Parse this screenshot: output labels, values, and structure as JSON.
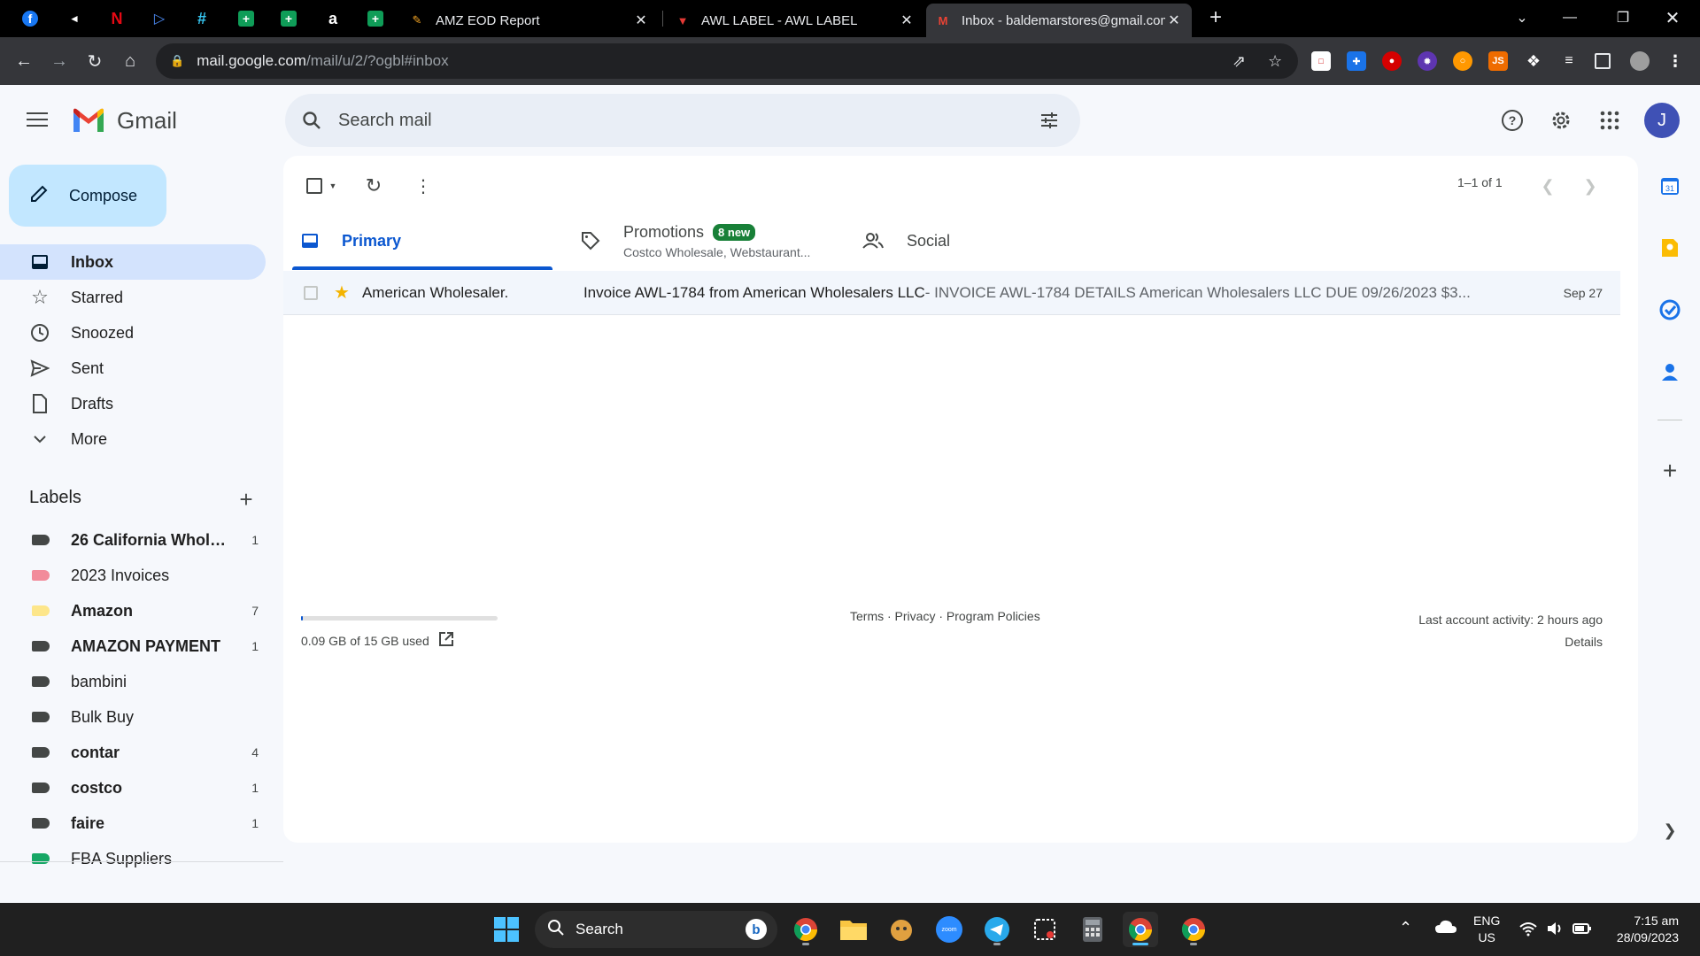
{
  "browser": {
    "tabs": [
      {
        "title": "AMZ EOD Report",
        "active": false
      },
      {
        "title": "AWL LABEL - AWL LABEL",
        "active": false
      },
      {
        "title": "Inbox - baldemarstores@gmail.com",
        "active": true
      }
    ],
    "url_host": "mail.google.com",
    "url_path": "/mail/u/2/?ogbl#inbox"
  },
  "gmail": {
    "brand": "Gmail",
    "search_placeholder": "Search mail",
    "avatar_letter": "J",
    "compose_label": "Compose",
    "nav": [
      {
        "label": "Inbox",
        "icon": "inbox-icon",
        "active": true
      },
      {
        "label": "Starred",
        "icon": "star-icon"
      },
      {
        "label": "Snoozed",
        "icon": "clock-icon"
      },
      {
        "label": "Sent",
        "icon": "send-icon"
      },
      {
        "label": "Drafts",
        "icon": "draft-icon"
      },
      {
        "label": "More",
        "icon": "chevron-down-icon"
      }
    ],
    "labels_title": "Labels",
    "labels": [
      {
        "name": "26 California Whole...",
        "count": "1",
        "bold": true,
        "color": "#444746"
      },
      {
        "name": "2023 Invoices",
        "count": "",
        "bold": false,
        "color": "#f28b9a"
      },
      {
        "name": "Amazon",
        "count": "7",
        "bold": true,
        "color": "#fde68a"
      },
      {
        "name": "AMAZON PAYMENT",
        "count": "1",
        "bold": true,
        "color": "#444746"
      },
      {
        "name": "bambini",
        "count": "",
        "bold": false,
        "color": "#444746"
      },
      {
        "name": "Bulk Buy",
        "count": "",
        "bold": false,
        "color": "#444746"
      },
      {
        "name": "contar",
        "count": "4",
        "bold": true,
        "color": "#444746"
      },
      {
        "name": "costco",
        "count": "1",
        "bold": true,
        "color": "#444746"
      },
      {
        "name": "faire",
        "count": "1",
        "bold": true,
        "color": "#444746"
      },
      {
        "name": "FBA Suppliers",
        "count": "",
        "bold": false,
        "color": "#16a765"
      }
    ],
    "pager": "1–1 of 1",
    "tabs": {
      "primary": "Primary",
      "promotions": "Promotions",
      "promotions_badge": "8 new",
      "promotions_sub": "Costco Wholesale, Webstaurant...",
      "social": "Social"
    },
    "emails": [
      {
        "sender": "American Wholesaler.",
        "subject": "Invoice AWL-1784 from American Wholesalers LLC",
        "snippet": " - INVOICE AWL-1784 DETAILS American Wholesalers LLC DUE 09/26/2023 $3...",
        "date": "Sep 27",
        "starred": true
      }
    ],
    "storage_text": "0.09 GB of 15 GB used",
    "storage_fraction": 0.006,
    "footer_links": "Terms · Privacy · Program Policies",
    "last_activity": "Last account activity: 2 hours ago",
    "details": "Details"
  },
  "taskbar": {
    "search_label": "Search",
    "lang_top": "ENG",
    "lang_bottom": "US",
    "time": "7:15 am",
    "date": "28/09/2023"
  }
}
